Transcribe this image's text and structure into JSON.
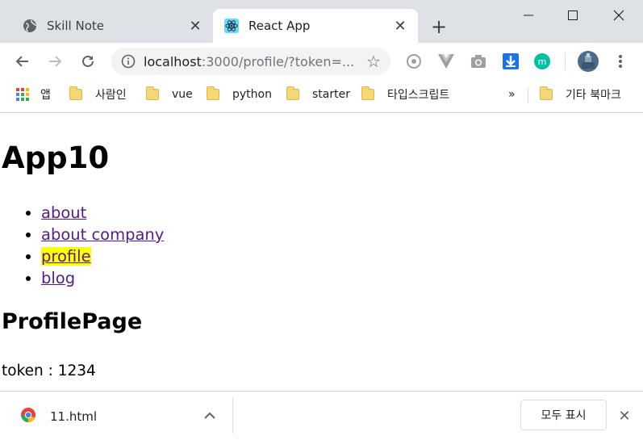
{
  "tabs": [
    {
      "title": "Skill Note",
      "favicon": "globe-icon"
    },
    {
      "title": "React App",
      "favicon": "react-icon"
    }
  ],
  "toolbar": {
    "url_host": "localhost",
    "url_path": ":3000/profile/?token=..."
  },
  "bookmarks": {
    "apps_label": "앱",
    "items": [
      "사람인",
      "vue",
      "python",
      "starter",
      "타입스크립트"
    ],
    "overflow": "»",
    "other_label": "기타 북마크"
  },
  "page": {
    "title": "App10",
    "nav": [
      {
        "label": "about"
      },
      {
        "label": "about company"
      },
      {
        "label": "profile"
      },
      {
        "label": "blog"
      }
    ],
    "section_title": "ProfilePage",
    "token_text": "token : 1234"
  },
  "downloads": {
    "file_name": "11.html",
    "show_all_label": "모두 표시"
  }
}
